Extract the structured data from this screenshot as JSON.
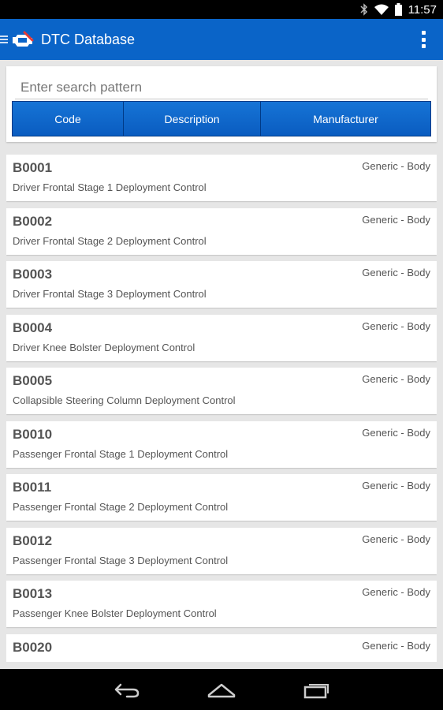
{
  "status_bar": {
    "time": "11:57"
  },
  "app_bar": {
    "title": "DTC Database"
  },
  "search": {
    "placeholder": "Enter search pattern",
    "buttons": {
      "code": "Code",
      "description": "Description",
      "manufacturer": "Manufacturer"
    }
  },
  "codes": [
    {
      "code": "B0001",
      "description": "Driver Frontal Stage 1 Deployment Control",
      "category": "Generic - Body"
    },
    {
      "code": "B0002",
      "description": "Driver Frontal Stage 2 Deployment Control",
      "category": "Generic - Body"
    },
    {
      "code": "B0003",
      "description": "Driver Frontal Stage 3 Deployment Control",
      "category": "Generic - Body"
    },
    {
      "code": "B0004",
      "description": "Driver Knee Bolster Deployment Control",
      "category": "Generic - Body"
    },
    {
      "code": "B0005",
      "description": "Collapsible Steering Column Deployment Control",
      "category": "Generic - Body"
    },
    {
      "code": "B0010",
      "description": "Passenger Frontal Stage 1 Deployment Control",
      "category": "Generic - Body"
    },
    {
      "code": "B0011",
      "description": "Passenger Frontal Stage 2 Deployment Control",
      "category": "Generic - Body"
    },
    {
      "code": "B0012",
      "description": "Passenger Frontal Stage 3 Deployment Control",
      "category": "Generic - Body"
    },
    {
      "code": "B0013",
      "description": "Passenger Knee Bolster Deployment Control",
      "category": "Generic - Body"
    },
    {
      "code": "B0020",
      "description": "",
      "category": "Generic - Body"
    }
  ],
  "icons": {
    "drawer": "hamburger-icon",
    "app": "car-engine-icon",
    "overflow": "overflow-menu-icon",
    "back": "back-icon",
    "home": "home-icon",
    "recents": "recent-apps-icon"
  },
  "colors": {
    "action_bar": "#0a64c8",
    "button": "#1068cc",
    "background": "#e6e6e6"
  }
}
